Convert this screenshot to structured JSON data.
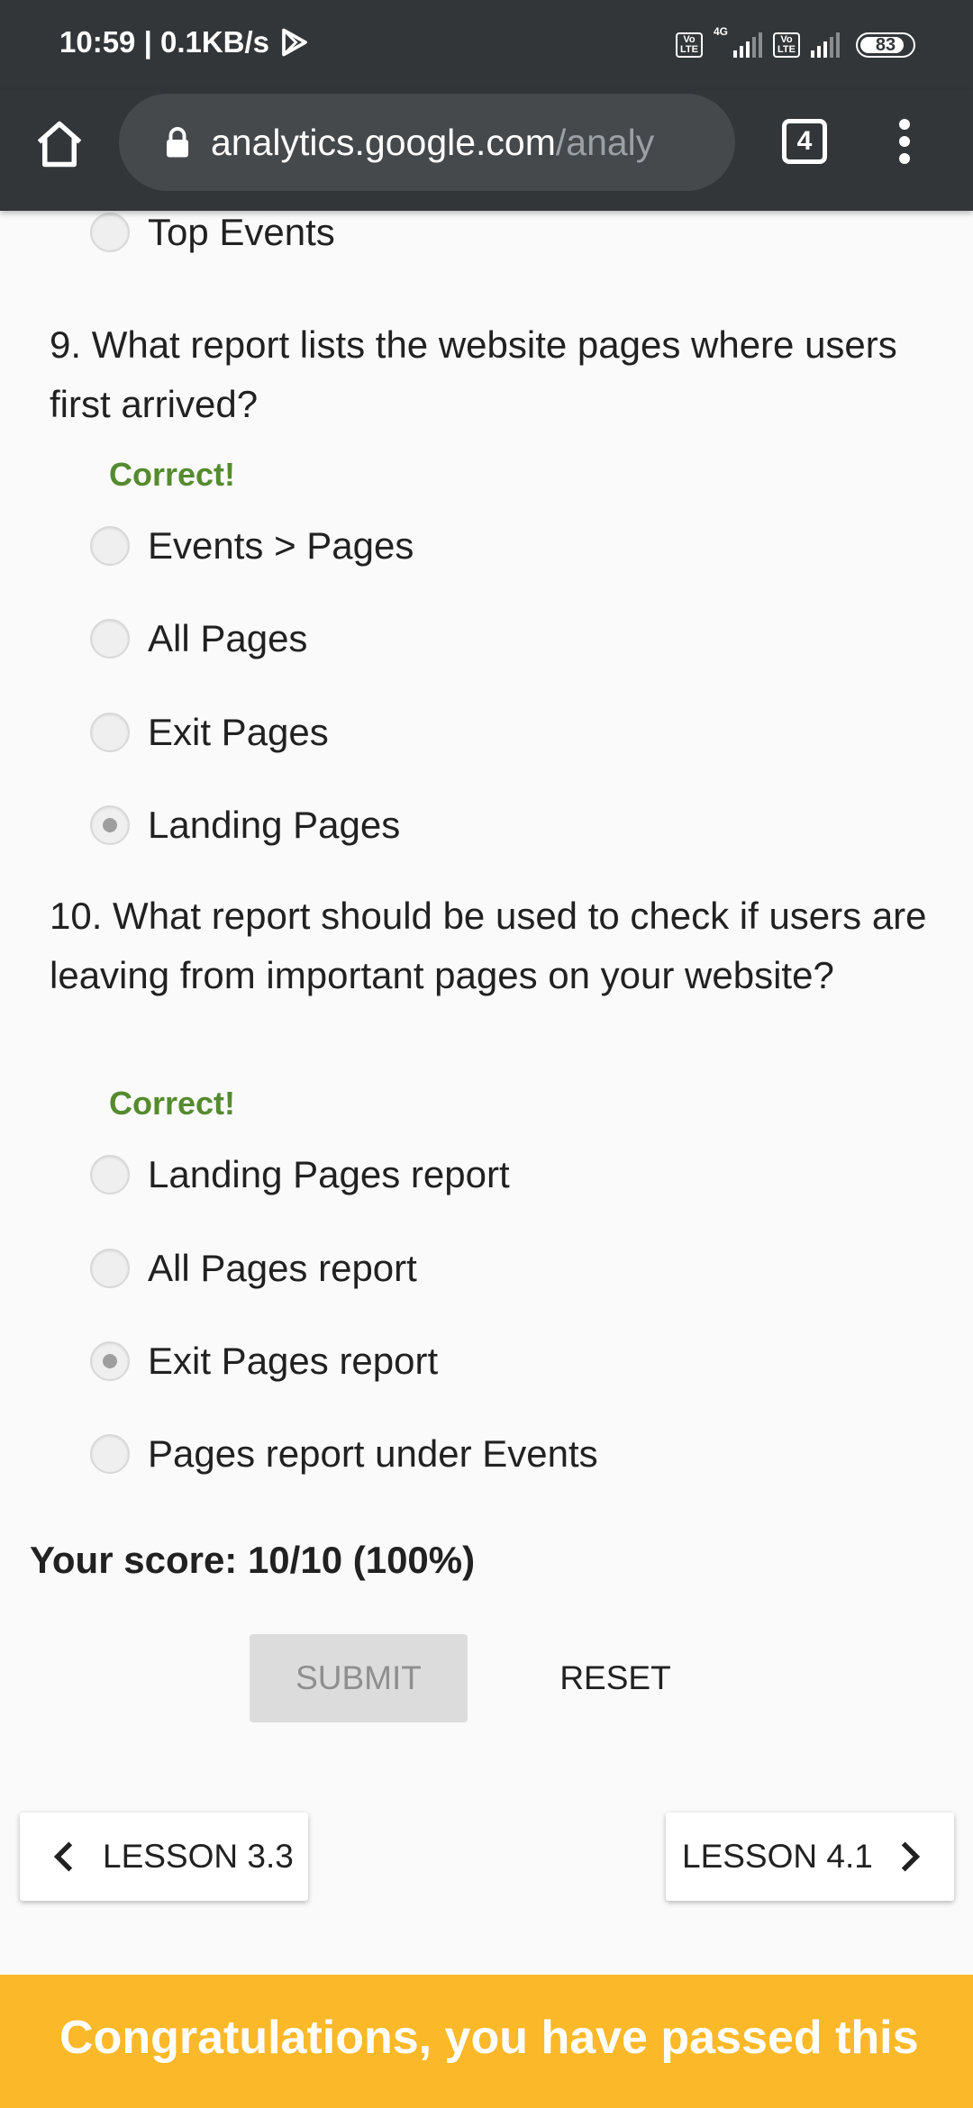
{
  "status_bar": {
    "time_speed": "10:59 | 0.1KB/s",
    "network_type": "4G",
    "volte_label": "Vo LTE",
    "battery": "83"
  },
  "browser": {
    "url_domain": "analytics.google.com",
    "url_path": "/analy",
    "tab_count": "4",
    "icons": [
      "home-icon",
      "lock-icon",
      "tabs-icon",
      "more-vert-icon"
    ]
  },
  "quiz": {
    "prev_option": "Top Events",
    "questions": [
      {
        "text": "9. What report lists the website pages where users first arrived?",
        "feedback": "Correct!",
        "options": [
          "Events > Pages",
          "All Pages",
          "Exit Pages",
          "Landing Pages"
        ],
        "selected_index": 3
      },
      {
        "text": "10. What report should be used to check if users are leaving from important pages on your website?",
        "feedback": "Correct!",
        "options": [
          "Landing Pages report",
          "All Pages report",
          "Exit Pages report",
          "Pages report under Events"
        ],
        "selected_index": 2
      }
    ],
    "score": "Your score: 10/10 (100%)",
    "submit_label": "SUBMIT",
    "reset_label": "RESET"
  },
  "navigation": {
    "prev_label": "LESSON 3.3",
    "next_label": "LESSON 4.1"
  },
  "banner": {
    "text": "Congratulations, you have passed this",
    "color": "#fbb829"
  },
  "colors": {
    "chrome_dark": "#323639",
    "correct_green": "#558b2f"
  }
}
